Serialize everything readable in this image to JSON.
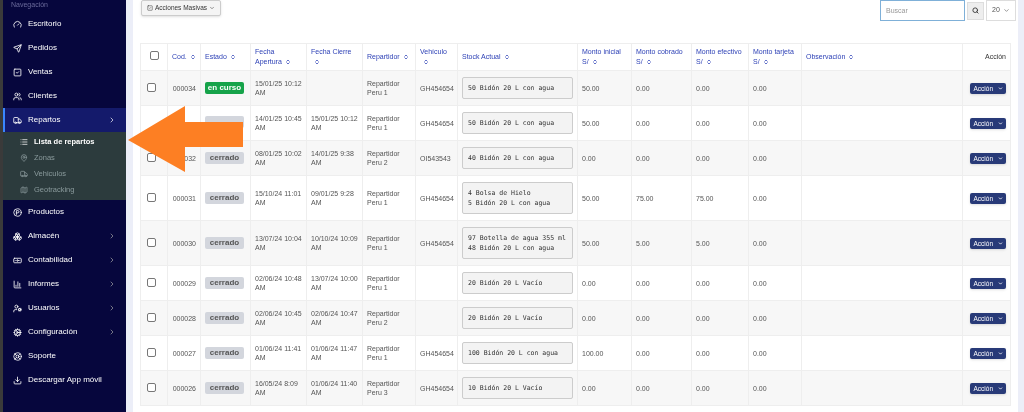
{
  "sidebar": {
    "heading": "Navegación",
    "items": [
      {
        "label": "Escritorio",
        "selected": false,
        "has_submenu": false
      },
      {
        "label": "Pedidos",
        "selected": false,
        "has_submenu": false
      },
      {
        "label": "Ventas",
        "selected": false,
        "has_submenu": false
      },
      {
        "label": "Clientes",
        "selected": false,
        "has_submenu": false
      },
      {
        "label": "Repartos",
        "selected": true,
        "has_submenu": true,
        "expanded": true,
        "children": [
          {
            "label": "Lista de repartos",
            "selected": true
          },
          {
            "label": "Zonas",
            "selected": false
          },
          {
            "label": "Vehiculos",
            "selected": false
          },
          {
            "label": "Geotracking",
            "selected": false
          }
        ]
      },
      {
        "label": "Productos",
        "selected": false,
        "has_submenu": false
      },
      {
        "label": "Almacén",
        "selected": false,
        "has_submenu": true,
        "expanded": false
      },
      {
        "label": "Contabilidad",
        "selected": false,
        "has_submenu": true,
        "expanded": false
      },
      {
        "label": "Informes",
        "selected": false,
        "has_submenu": true,
        "expanded": false
      },
      {
        "label": "Usuarios",
        "selected": false,
        "has_submenu": true,
        "expanded": false
      },
      {
        "label": "Configuración",
        "selected": false,
        "has_submenu": true,
        "expanded": false
      },
      {
        "label": "Soporte",
        "selected": false,
        "has_submenu": false
      },
      {
        "label": "Descargar App móvil",
        "selected": false,
        "has_submenu": false
      }
    ]
  },
  "toolbar": {
    "bulk_actions": "Acciones Masivas",
    "search": {
      "placeholder": "Buscar"
    },
    "page_size": "20"
  },
  "table": {
    "select_all_checked": false,
    "columns": [
      {
        "label": "Cod.",
        "sortable": true
      },
      {
        "label": "Estado",
        "sortable": true
      },
      {
        "label": "Fecha Apertura",
        "sortable": true
      },
      {
        "label": "Fecha Cierre",
        "sortable": true
      },
      {
        "label": "Repartidor",
        "sortable": true
      },
      {
        "label": "Vehículo",
        "sortable": true
      },
      {
        "label": "Stock Actual",
        "sortable": true
      },
      {
        "label": "Monto inicial S/",
        "sortable": true
      },
      {
        "label": "Monto cobrado S/",
        "sortable": true
      },
      {
        "label": "Monto efectivo S/",
        "sortable": true
      },
      {
        "label": "Monto tarjeta S/",
        "sortable": true
      },
      {
        "label": "Observación",
        "sortable": true
      },
      {
        "label": "Acción",
        "sortable": false
      }
    ],
    "rows": [
      {
        "checked": false,
        "code": "000034",
        "status": {
          "kind": "open",
          "label": "en curso"
        },
        "opened": "15/01/25 10:12 AM",
        "driver": "Repartidor Peru 1",
        "vehicle": "GH454654",
        "stock": [
          "50 Bidón 20 L con agua"
        ],
        "initial": "50.00",
        "collected": "0.00",
        "cash": "0.00",
        "card": "0.00",
        "action": "Acción"
      },
      {
        "status": {
          "kind": "closed"
        },
        "opened": "14/01/25 10:45 AM",
        "closed": "15/01/25 10:12 AM",
        "driver": "Repartidor Peru 1",
        "vehicle": "GH454654",
        "stock": [
          "50 Bidón 20 L con agua"
        ],
        "initial": "50.00",
        "collected": "0.00",
        "cash": "0.00",
        "card": "0.00",
        "action": "Acción"
      },
      {
        "checked": false,
        "code": "032",
        "status": {
          "kind": "closed",
          "label": "cerrado"
        },
        "opened": "08/01/25 10:02 AM",
        "closed": "14/01/25 9:38 AM",
        "driver": "Repartidor Peru 2",
        "vehicle": "OI543543",
        "stock": [
          "40 Bidón 20 L con agua"
        ],
        "initial": "0.00",
        "collected": "0.00",
        "cash": "0.00",
        "card": "0.00",
        "action": "Acción"
      },
      {
        "checked": false,
        "code": "000031",
        "status": {
          "kind": "closed",
          "label": "cerrado"
        },
        "opened": "15/10/24 11:01 AM",
        "closed": "09/01/25 9:28 AM",
        "driver": "Repartidor Peru 1",
        "vehicle": "GH454654",
        "stock": [
          "4 Bolsa de Hielo",
          "5 Bidón 20 L con agua"
        ],
        "initial": "50.00",
        "collected": "75.00",
        "cash": "75.00",
        "card": "0.00",
        "action": "Acción"
      },
      {
        "checked": false,
        "code": "000030",
        "status": {
          "kind": "closed",
          "label": "cerrado"
        },
        "opened": "13/07/24 10:04 AM",
        "closed": "10/10/24 10:09 AM",
        "driver": "Repartidor Peru 1",
        "vehicle": "GH454654",
        "stock": [
          "97 Botella de agua 355 ml",
          "48 Bidón 20 L con agua"
        ],
        "initial": "50.00",
        "collected": "5.00",
        "cash": "5.00",
        "card": "0.00",
        "action": "Acción"
      },
      {
        "checked": false,
        "code": "000029",
        "status": {
          "kind": "closed",
          "label": "cerrado"
        },
        "opened": "02/06/24 10:48 AM",
        "closed": "13/07/24 10:00 AM",
        "driver": "Repartidor Peru 1",
        "stock": [
          "20 Bidón 20 L Vacío"
        ],
        "initial": "0.00",
        "collected": "0.00",
        "cash": "0.00",
        "card": "0.00",
        "action": "Acción"
      },
      {
        "checked": false,
        "code": "000028",
        "status": {
          "kind": "closed",
          "label": "cerrado"
        },
        "opened": "02/06/24 10:45 AM",
        "closed": "02/06/24 10:47 AM",
        "driver": "Repartidor Peru 2",
        "stock": [
          "20 Bidón 20 L Vacío"
        ],
        "initial": "0.00",
        "collected": "0.00",
        "cash": "0.00",
        "card": "0.00",
        "action": "Acción"
      },
      {
        "checked": false,
        "code": "000027",
        "status": {
          "kind": "closed",
          "label": "cerrado"
        },
        "opened": "01/06/24 11:41 AM",
        "closed": "01/06/24 11:47 AM",
        "driver": "Repartidor Peru 1",
        "vehicle": "GH454654",
        "stock": [
          "100 Bidón 20 L con agua"
        ],
        "initial": "100.00",
        "collected": "0.00",
        "cash": "0.00",
        "card": "0.00",
        "action": "Acción"
      },
      {
        "checked": false,
        "code": "000026",
        "status": {
          "kind": "closed",
          "label": "cerrado"
        },
        "opened": "16/05/24 8:09 AM",
        "closed": "01/06/24 11:40 AM",
        "driver": "Repartidor Peru 3",
        "vehicle": "GH454654",
        "stock": [
          "10 Bidón 20 L Vacío"
        ],
        "initial": "0.00",
        "collected": "0.00",
        "cash": "0.00",
        "card": "0.00",
        "action": "Acción"
      }
    ]
  }
}
